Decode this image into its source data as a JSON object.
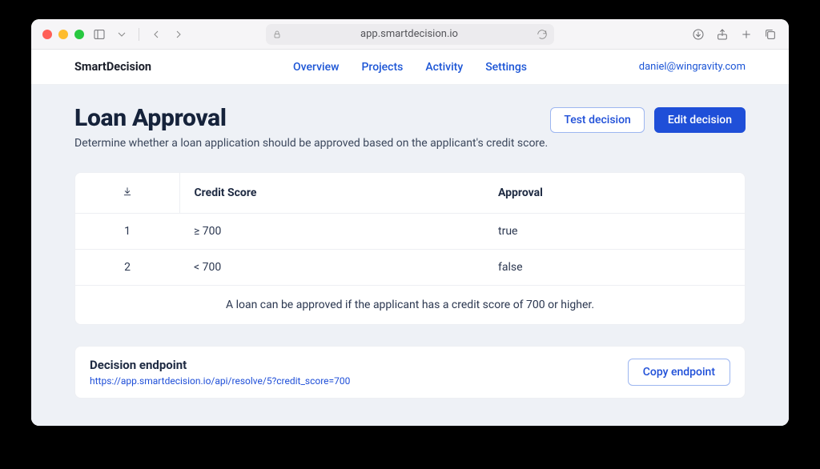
{
  "browser": {
    "url": "app.smartdecision.io"
  },
  "brand": "SmartDecision",
  "nav": {
    "overview": "Overview",
    "projects": "Projects",
    "activity": "Activity",
    "settings": "Settings"
  },
  "user_email": "daniel@wingravity.com",
  "page": {
    "title": "Loan Approval",
    "subtitle": "Determine whether a loan application should be approved based on the applicant's credit score.",
    "test_label": "Test decision",
    "edit_label": "Edit decision"
  },
  "table": {
    "col1": "Credit Score",
    "col2": "Approval",
    "rows": [
      {
        "idx": "1",
        "score": "≥ 700",
        "approval": "true"
      },
      {
        "idx": "2",
        "score": "< 700",
        "approval": "false"
      }
    ],
    "note": "A loan can be approved if the applicant has a credit score of 700 or higher."
  },
  "endpoint": {
    "title": "Decision endpoint",
    "url": "https://app.smartdecision.io/api/resolve/5?credit_score=700",
    "copy_label": "Copy endpoint"
  }
}
